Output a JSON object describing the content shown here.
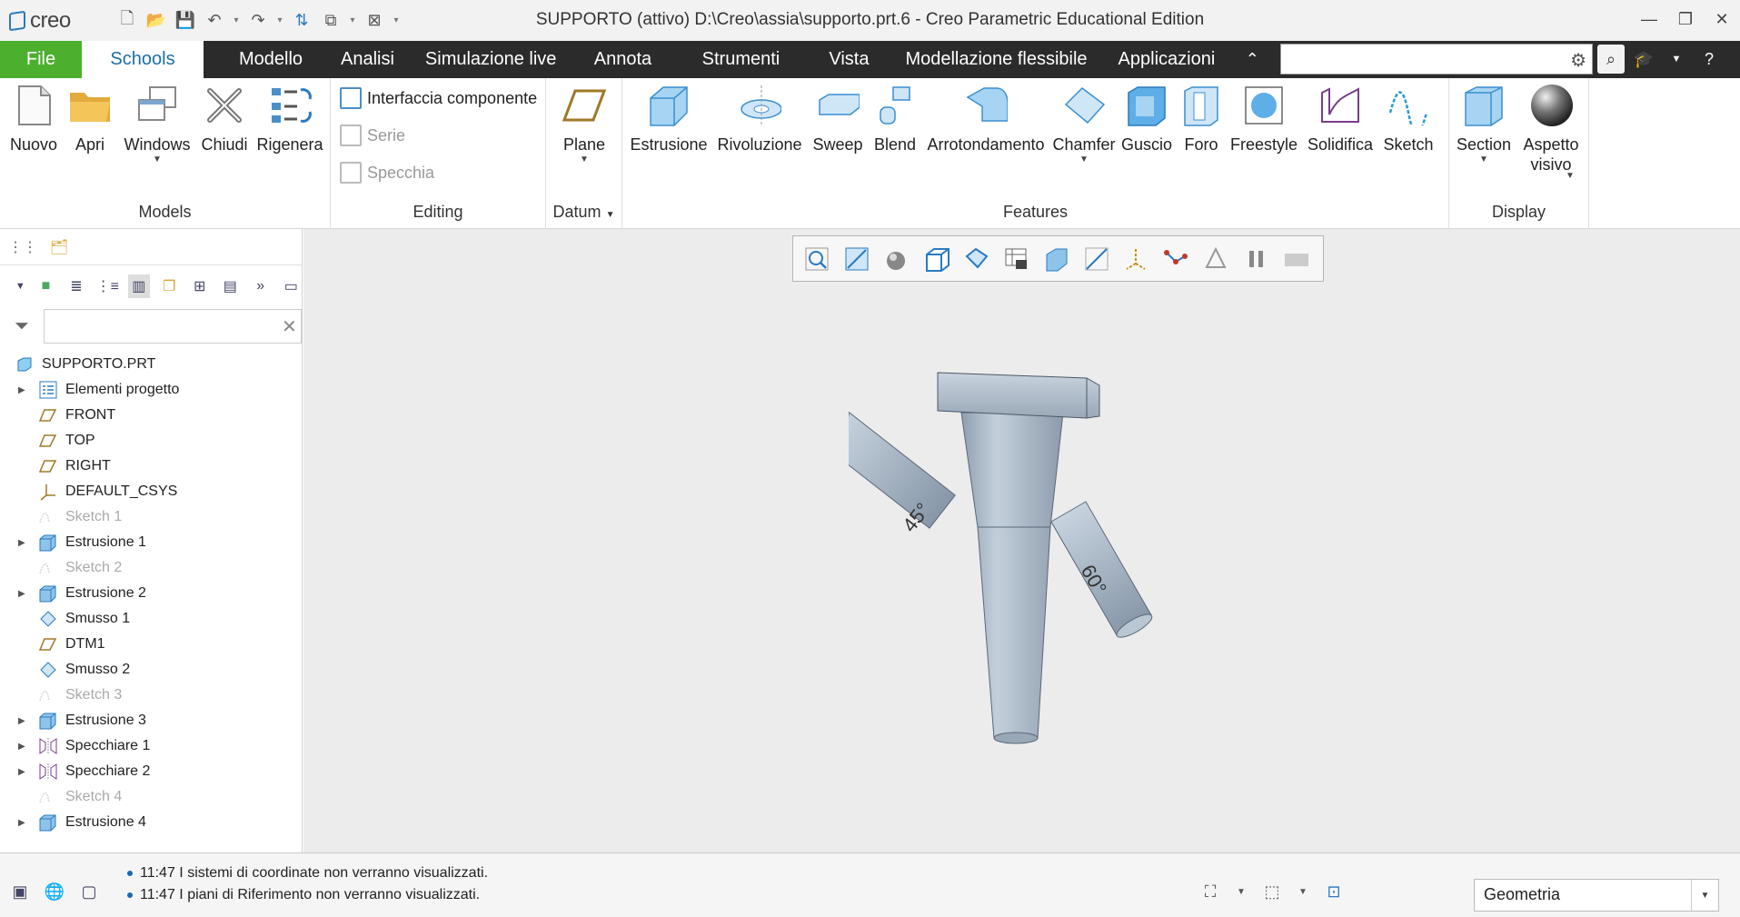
{
  "app": {
    "logo_text": "creo",
    "window_title": "SUPPORTO (attivo) D:\\Creo\\assia\\supporto.prt.6 - Creo Parametric Educational Edition"
  },
  "menubar": {
    "tabs": [
      {
        "label": "File"
      },
      {
        "label": "Schools"
      },
      {
        "label": "Modello"
      },
      {
        "label": "Analisi"
      },
      {
        "label": "Simulazione live"
      },
      {
        "label": "Annota"
      },
      {
        "label": "Strumenti"
      },
      {
        "label": "Vista"
      },
      {
        "label": "Modellazione flessibile"
      },
      {
        "label": "Applicazioni"
      }
    ],
    "search_value": ""
  },
  "ribbon": {
    "groups": {
      "models": {
        "label": "Models",
        "buttons": [
          "Nuovo",
          "Apri",
          "Windows",
          "Chiudi",
          "Rigenera"
        ]
      },
      "editing": {
        "label": "Editing",
        "buttons": [
          "Interfaccia componente",
          "Serie",
          "Specchia"
        ]
      },
      "datum": {
        "label": "Datum",
        "buttons": [
          "Plane"
        ]
      },
      "features": {
        "label": "Features",
        "buttons": [
          "Estrusione",
          "Rivoluzione",
          "Sweep",
          "Blend",
          "Arrotondamento",
          "Chamfer",
          "Guscio",
          "Foro",
          "Freestyle",
          "Solidifica",
          "Sketch"
        ]
      },
      "display": {
        "label": "Display",
        "buttons": [
          "Section",
          "Aspetto visivo"
        ]
      }
    }
  },
  "model_tree": {
    "filter_value": "",
    "root": "SUPPORTO.PRT",
    "items": [
      {
        "label": "Elementi progetto",
        "icon": "design-items-icon",
        "expandable": true,
        "dim": false
      },
      {
        "label": "FRONT",
        "icon": "datum-plane-icon",
        "expandable": false,
        "dim": false
      },
      {
        "label": "TOP",
        "icon": "datum-plane-icon",
        "expandable": false,
        "dim": false
      },
      {
        "label": "RIGHT",
        "icon": "datum-plane-icon",
        "expandable": false,
        "dim": false
      },
      {
        "label": "DEFAULT_CSYS",
        "icon": "csys-icon",
        "expandable": false,
        "dim": false
      },
      {
        "label": "Sketch 1",
        "icon": "sketch-icon",
        "expandable": false,
        "dim": true
      },
      {
        "label": "Estrusione 1",
        "icon": "extrude-icon",
        "expandable": true,
        "dim": false
      },
      {
        "label": "Sketch 2",
        "icon": "sketch-icon",
        "expandable": false,
        "dim": true
      },
      {
        "label": "Estrusione 2",
        "icon": "extrude-icon",
        "expandable": true,
        "dim": false
      },
      {
        "label": "Smusso 1",
        "icon": "chamfer-icon",
        "expandable": false,
        "dim": false
      },
      {
        "label": "DTM1",
        "icon": "datum-plane-icon",
        "expandable": false,
        "dim": false
      },
      {
        "label": "Smusso 2",
        "icon": "chamfer-icon",
        "expandable": false,
        "dim": false
      },
      {
        "label": "Sketch 3",
        "icon": "sketch-icon",
        "expandable": false,
        "dim": true
      },
      {
        "label": "Estrusione 3",
        "icon": "extrude-icon",
        "expandable": true,
        "dim": false
      },
      {
        "label": "Specchiare 1",
        "icon": "mirror-icon",
        "expandable": true,
        "dim": false
      },
      {
        "label": "Specchiare 2",
        "icon": "mirror-icon",
        "expandable": true,
        "dim": false
      },
      {
        "label": "Sketch 4",
        "icon": "sketch-icon",
        "expandable": false,
        "dim": true
      },
      {
        "label": "Estrusione 4",
        "icon": "extrude-icon",
        "expandable": true,
        "dim": false
      }
    ]
  },
  "viewport": {
    "model_labels": [
      "45°",
      "60°"
    ]
  },
  "statusbar": {
    "messages": [
      "11:47 I sistemi di coordinate non verranno visualizzati.",
      "11:47 I piani di Riferimento non verranno visualizzati."
    ],
    "selection_filter": "Geometria"
  },
  "colors": {
    "file_tab": "#4caf2e",
    "menubar_bg": "#2b2b2b",
    "active_tab_text": "#1b6ea8",
    "viewport_bg": "#ececec",
    "model_body": "#a9b8c8"
  }
}
